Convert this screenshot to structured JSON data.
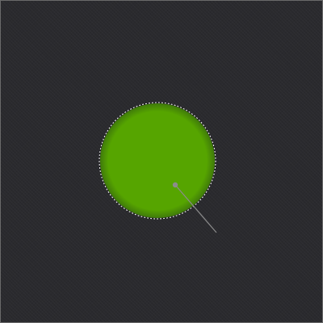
{
  "canvas": {
    "background_color": "#2a2a2e",
    "border_color": "#6a6a6a"
  },
  "shape": {
    "kind": "circle",
    "fill_color": "#56a500",
    "edge_color": "#3f7a0a",
    "selection_outline_color": "#ffffff",
    "selection_style": "dashed"
  },
  "drag_handle": {
    "icon": "pivot-handle-icon",
    "color": "#8c8c8c"
  }
}
